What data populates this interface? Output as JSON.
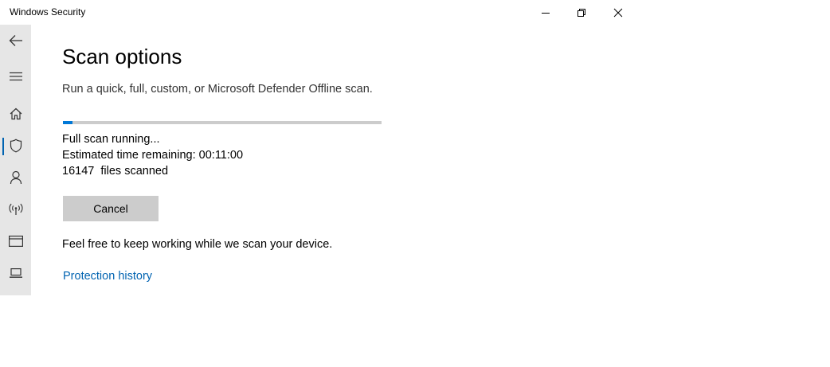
{
  "window": {
    "title": "Windows Security",
    "controls": [
      "minimize-icon",
      "restore-icon",
      "close-icon"
    ]
  },
  "sidebar": {
    "items": [
      {
        "icon": "back-arrow-icon"
      },
      {
        "icon": "hamburger-menu-icon"
      },
      {
        "icon": "home-icon"
      },
      {
        "icon": "shield-icon",
        "selected": true
      },
      {
        "icon": "person-icon"
      },
      {
        "icon": "wireless-icon"
      },
      {
        "icon": "app-browser-icon"
      },
      {
        "icon": "laptop-icon"
      }
    ],
    "selected_accent": "#0063b1"
  },
  "main": {
    "title": "Scan options",
    "subtitle": "Run a quick, full, custom, or Microsoft Defender Offline scan.",
    "progress_fraction": 0.03,
    "status": {
      "running": "Full scan running...",
      "time_label": "Estimated time remaining:",
      "time_value": "00:11:00",
      "files_count": "16147",
      "files_label": "files scanned"
    },
    "cancel_label": "Cancel",
    "info": "Feel free to keep working while we scan your device.",
    "history_link": "Protection history"
  },
  "colors": {
    "accent": "#0078d7",
    "link": "#0063b1",
    "sidebar_bg": "#e6e6e6",
    "button_bg": "#cccccc"
  }
}
